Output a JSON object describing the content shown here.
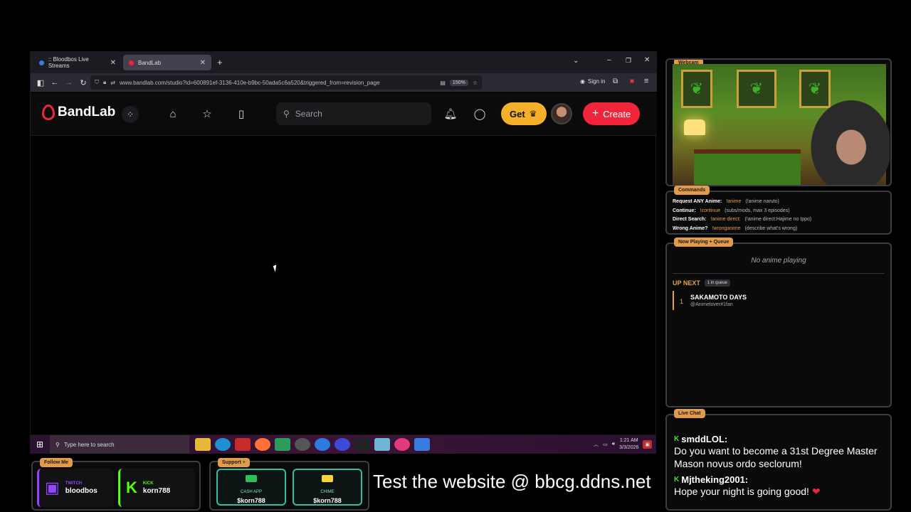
{
  "browser": {
    "tabs": [
      {
        "label": ":: Bloodbos Live Streams",
        "active": false
      },
      {
        "label": "BandLab",
        "active": true
      }
    ],
    "url": "www.bandlab.com/studio?id=600891ef-3136-410e-b9bc-50ada5c6a520&triggered_from=revision_page",
    "zoom": "150%",
    "sign_in": "Sign in"
  },
  "bandlab": {
    "logo": "BandLab",
    "search_placeholder": "Search",
    "get_label": "Get",
    "create_label": "Create"
  },
  "taskbar": {
    "search_placeholder": "Type here to search",
    "time": "1:21 AM",
    "date": "3/3/2026"
  },
  "overlay": {
    "panels": {
      "webcam": "Webcam",
      "commands": "Commands",
      "now_playing": "Now Playing + Queue",
      "live_chat": "Live Chat",
      "follow": "Follow Me",
      "support": "Support"
    },
    "commands": [
      {
        "label": "Request ANY Anime:",
        "cmd": "!anime",
        "desc": "(!anime naruto)"
      },
      {
        "label": "Continue:",
        "cmd": "!continue",
        "desc": "(subs/mods, max 3 episodes)"
      },
      {
        "label": "Direct Search:",
        "cmd": "!anime direct:",
        "desc": "(!anime direct:Hajime no Ippo)"
      },
      {
        "label": "Wrong Anime?",
        "cmd": "!wronganime",
        "desc": "(describe what's wrong)"
      }
    ],
    "now_playing": {
      "empty_text": "No anime playing",
      "up_next": "UP NEXT",
      "queue_count": "1 in queue",
      "queue": [
        {
          "num": "1",
          "title": "SAKAMOTO DAYS",
          "user": "@Animelover#1fan"
        }
      ]
    },
    "chat": [
      {
        "user": "smddLOL:",
        "message": "Do you want to become a 31st Degree Master Mason novus ordo seclorum!"
      },
      {
        "user": "Mjtheking2001:",
        "message": "Hope your night is going good!"
      }
    ],
    "follow": [
      {
        "platform": "TWITCH",
        "name": "bloodbos",
        "color": "#9146ff"
      },
      {
        "platform": "KICK",
        "name": "korn788",
        "color": "#53fc18"
      }
    ],
    "support": [
      {
        "platform": "CASH APP",
        "name": "$korn788",
        "color": "#2fbf5a"
      },
      {
        "platform": "CHIME",
        "name": "$korn788",
        "color": "#f5d33a"
      }
    ],
    "banner": "Test the website @ bbcg.ddns.net"
  }
}
